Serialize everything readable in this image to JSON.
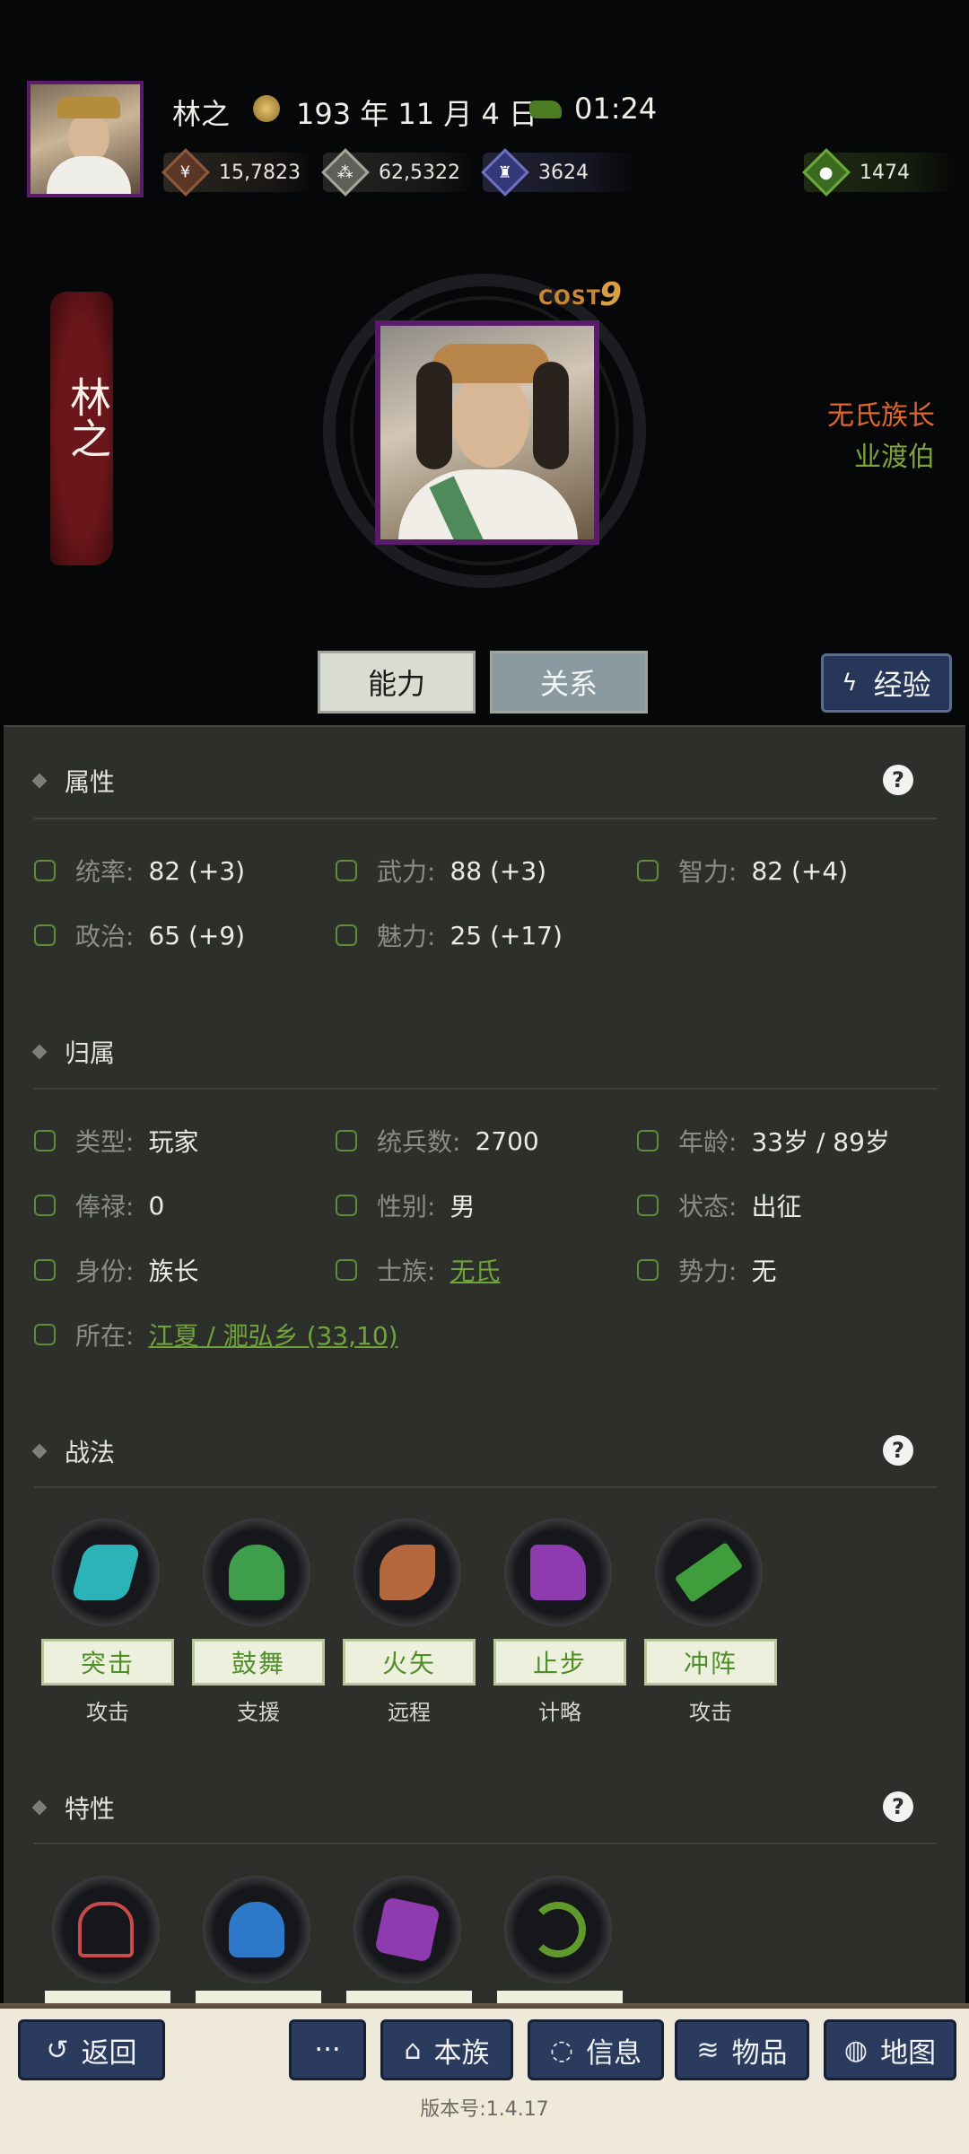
{
  "header": {
    "name": "林之",
    "date": "193 年 11 月 4 日",
    "time": "01:24",
    "resources": [
      {
        "icon": "coin-icon",
        "value": "15,7823",
        "color": "#7a4a34"
      },
      {
        "icon": "grain-icon",
        "value": "62,5322",
        "color": "#8c8c80"
      },
      {
        "icon": "soldier-icon",
        "value": "3624",
        "color": "#4c4f9c"
      },
      {
        "icon": "pouch-icon",
        "value": "1474",
        "color": "#4f8a2a"
      }
    ]
  },
  "profile": {
    "banner_name": "林之",
    "cost_label": "COST",
    "cost_value": "9",
    "title1": "无氏族长",
    "title2": "业渡伯"
  },
  "tabs": [
    "能力",
    "关系"
  ],
  "exp_button": "经验",
  "attributes": {
    "title": "属性",
    "items": [
      {
        "label": "统率:",
        "value": "82 (+3)"
      },
      {
        "label": "武力:",
        "value": "88 (+3)"
      },
      {
        "label": "智力:",
        "value": "82 (+4)"
      },
      {
        "label": "政治:",
        "value": "65 (+9)"
      },
      {
        "label": "魅力:",
        "value": "25 (+17)"
      }
    ]
  },
  "belonging": {
    "title": "归属",
    "items": [
      {
        "label": "类型:",
        "value": "玩家"
      },
      {
        "label": "统兵数:",
        "value": "2700"
      },
      {
        "label": "年龄:",
        "value": "33岁 / 89岁"
      },
      {
        "label": "俸禄:",
        "value": "0"
      },
      {
        "label": "性别:",
        "value": "男"
      },
      {
        "label": "状态:",
        "value": "出征"
      },
      {
        "label": "身份:",
        "value": "族长"
      },
      {
        "label": "士族:",
        "value": "无氏"
      },
      {
        "label": "势力:",
        "value": "无"
      }
    ],
    "location_label": "所在:",
    "location_value": "江夏 / 淝弘乡 (33,10)"
  },
  "tactics": {
    "title": "战法",
    "items": [
      {
        "name": "突击",
        "type": "攻击",
        "color": "#2bb3b8"
      },
      {
        "name": "鼓舞",
        "type": "支援",
        "color": "#3f9e4b"
      },
      {
        "name": "火矢",
        "type": "远程",
        "color": "#b5673d"
      },
      {
        "name": "止步",
        "type": "计略",
        "color": "#8e3bb0"
      },
      {
        "name": "冲阵",
        "type": "攻击",
        "color": "#3f9e3b"
      }
    ]
  },
  "traits": {
    "title": "特性",
    "colors": [
      "#c94a4a",
      "#2d78c8",
      "#8e3bb0",
      "#5f9a2a"
    ]
  },
  "footer": {
    "back": "返回",
    "more": "···",
    "clan": "本族",
    "info": "信息",
    "items": "物品",
    "map": "地图",
    "version": "版本号:1.4.17"
  }
}
